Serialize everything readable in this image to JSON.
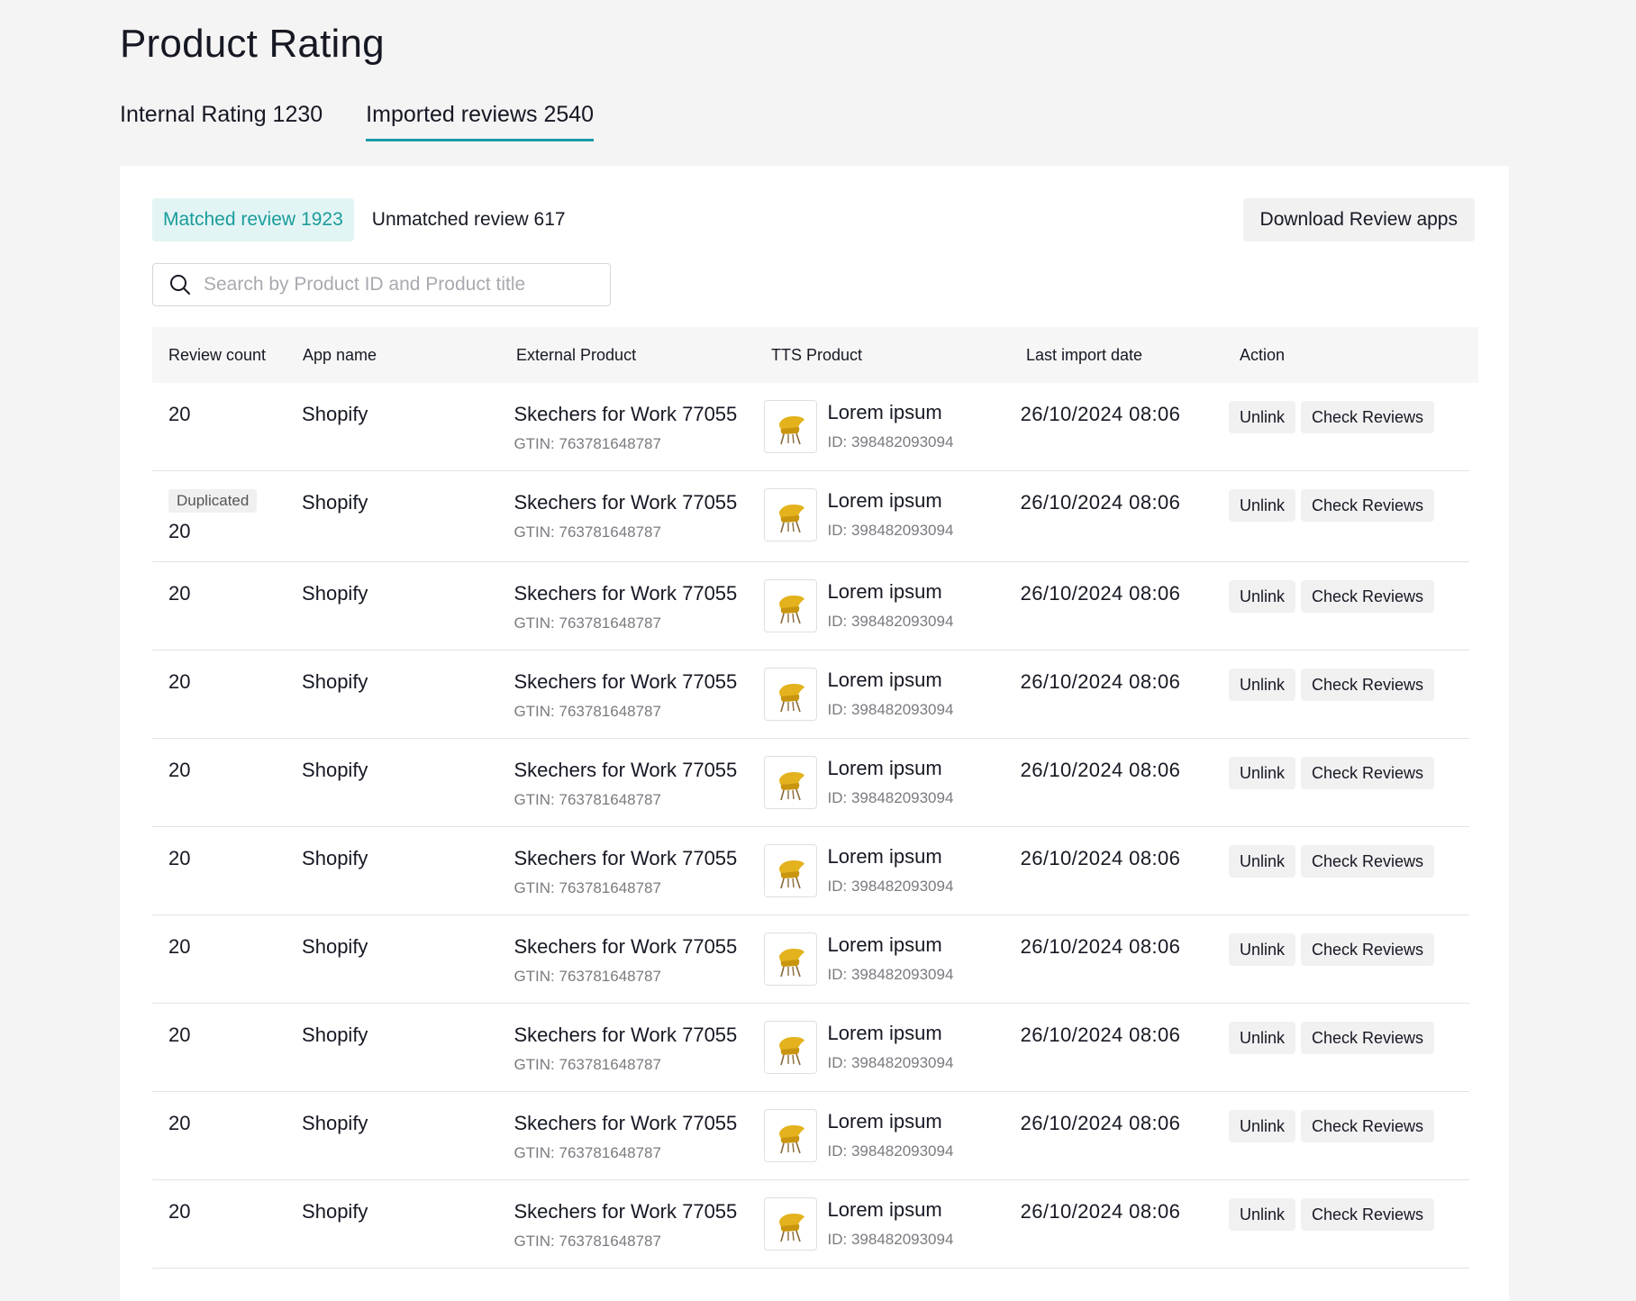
{
  "page": {
    "title": "Product Rating"
  },
  "top_tabs": [
    {
      "label": "Internal Rating 1230",
      "active": false
    },
    {
      "label": "Imported reviews 2540",
      "active": true
    }
  ],
  "sub_tabs": {
    "matched_label": "Matched review",
    "matched_count": "1923",
    "unmatched": "Unmatched review 617"
  },
  "download_label": "Download Review apps",
  "search": {
    "placeholder": "Search by Product ID and Product title",
    "value": ""
  },
  "columns": [
    "Review count",
    "App name",
    "External Product",
    "TTS Product",
    "Last import date",
    "Action"
  ],
  "duplicated_label": "Duplicated",
  "actions": {
    "unlink": "Unlink",
    "check": "Check Reviews"
  },
  "rows": [
    {
      "count": "20",
      "duplicated": false,
      "app": "Shopify",
      "ext_title": "Skechers for Work 77055",
      "ext_gtin": "GTIN: 763781648787",
      "tts_title": "Lorem ipsum",
      "tts_id": "ID: 398482093094",
      "date": "26/10/2024 08:06"
    },
    {
      "count": "20",
      "duplicated": true,
      "app": "Shopify",
      "ext_title": "Skechers for Work 77055",
      "ext_gtin": "GTIN: 763781648787",
      "tts_title": "Lorem ipsum",
      "tts_id": "ID: 398482093094",
      "date": "26/10/2024 08:06"
    },
    {
      "count": "20",
      "duplicated": false,
      "app": "Shopify",
      "ext_title": "Skechers for Work 77055",
      "ext_gtin": "GTIN: 763781648787",
      "tts_title": "Lorem ipsum",
      "tts_id": "ID: 398482093094",
      "date": "26/10/2024 08:06"
    },
    {
      "count": "20",
      "duplicated": false,
      "app": "Shopify",
      "ext_title": "Skechers for Work 77055",
      "ext_gtin": "GTIN: 763781648787",
      "tts_title": "Lorem ipsum",
      "tts_id": "ID: 398482093094",
      "date": "26/10/2024 08:06"
    },
    {
      "count": "20",
      "duplicated": false,
      "app": "Shopify",
      "ext_title": "Skechers for Work 77055",
      "ext_gtin": "GTIN: 763781648787",
      "tts_title": "Lorem ipsum",
      "tts_id": "ID: 398482093094",
      "date": "26/10/2024 08:06"
    },
    {
      "count": "20",
      "duplicated": false,
      "app": "Shopify",
      "ext_title": "Skechers for Work 77055",
      "ext_gtin": "GTIN: 763781648787",
      "tts_title": "Lorem ipsum",
      "tts_id": "ID: 398482093094",
      "date": "26/10/2024 08:06"
    },
    {
      "count": "20",
      "duplicated": false,
      "app": "Shopify",
      "ext_title": "Skechers for Work 77055",
      "ext_gtin": "GTIN: 763781648787",
      "tts_title": "Lorem ipsum",
      "tts_id": "ID: 398482093094",
      "date": "26/10/2024 08:06"
    },
    {
      "count": "20",
      "duplicated": false,
      "app": "Shopify",
      "ext_title": "Skechers for Work 77055",
      "ext_gtin": "GTIN: 763781648787",
      "tts_title": "Lorem ipsum",
      "tts_id": "ID: 398482093094",
      "date": "26/10/2024 08:06"
    },
    {
      "count": "20",
      "duplicated": false,
      "app": "Shopify",
      "ext_title": "Skechers for Work 77055",
      "ext_gtin": "GTIN: 763781648787",
      "tts_title": "Lorem ipsum",
      "tts_id": "ID: 398482093094",
      "date": "26/10/2024 08:06"
    },
    {
      "count": "20",
      "duplicated": false,
      "app": "Shopify",
      "ext_title": "Skechers for Work 77055",
      "ext_gtin": "GTIN: 763781648787",
      "tts_title": "Lorem ipsum",
      "tts_id": "ID: 398482093094",
      "date": "26/10/2024 08:06"
    }
  ],
  "colors": {
    "accent": "#1b9aa6",
    "accent_bg": "#e3f4f4",
    "page_bg": "#f4f4f4"
  },
  "icons": {
    "search": "search-icon",
    "product_thumb": "chair-thumbnail"
  }
}
